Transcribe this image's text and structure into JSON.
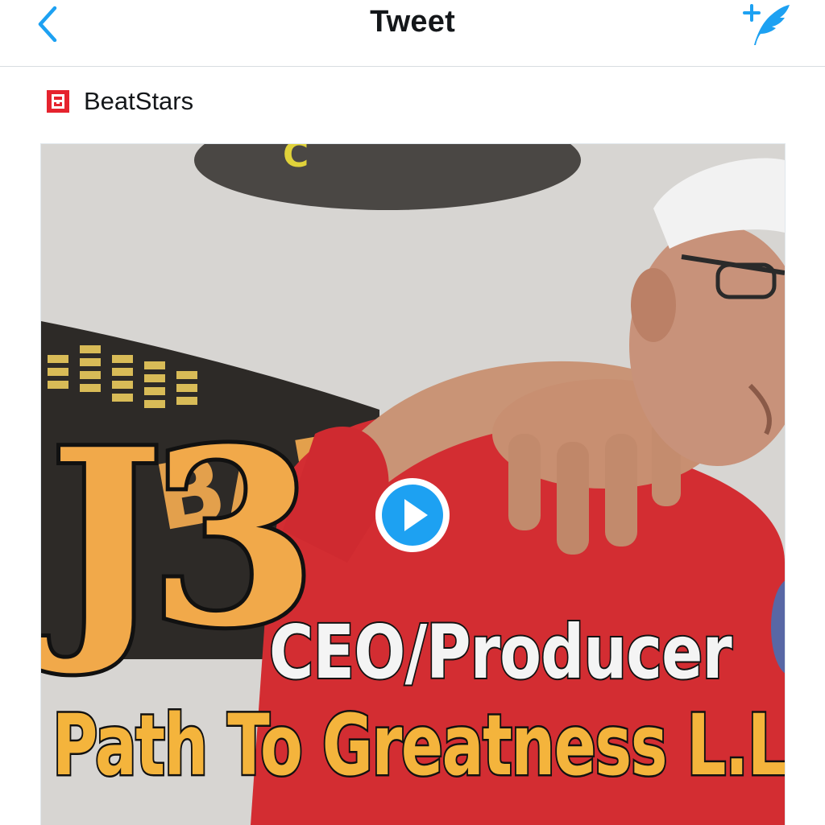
{
  "nav": {
    "back_icon": "chevron-left-icon",
    "title": "Tweet",
    "compose_icon": "compose-tweet-icon"
  },
  "accent_color": "#1da1f2",
  "card": {
    "source_name": "BeatStars",
    "source_logo_color": "#e5232e",
    "play_icon": "play-icon",
    "overlay": {
      "title": "J3",
      "subtitle": "CEO/Producer",
      "company": "Path To Greatness L.L.C."
    }
  }
}
